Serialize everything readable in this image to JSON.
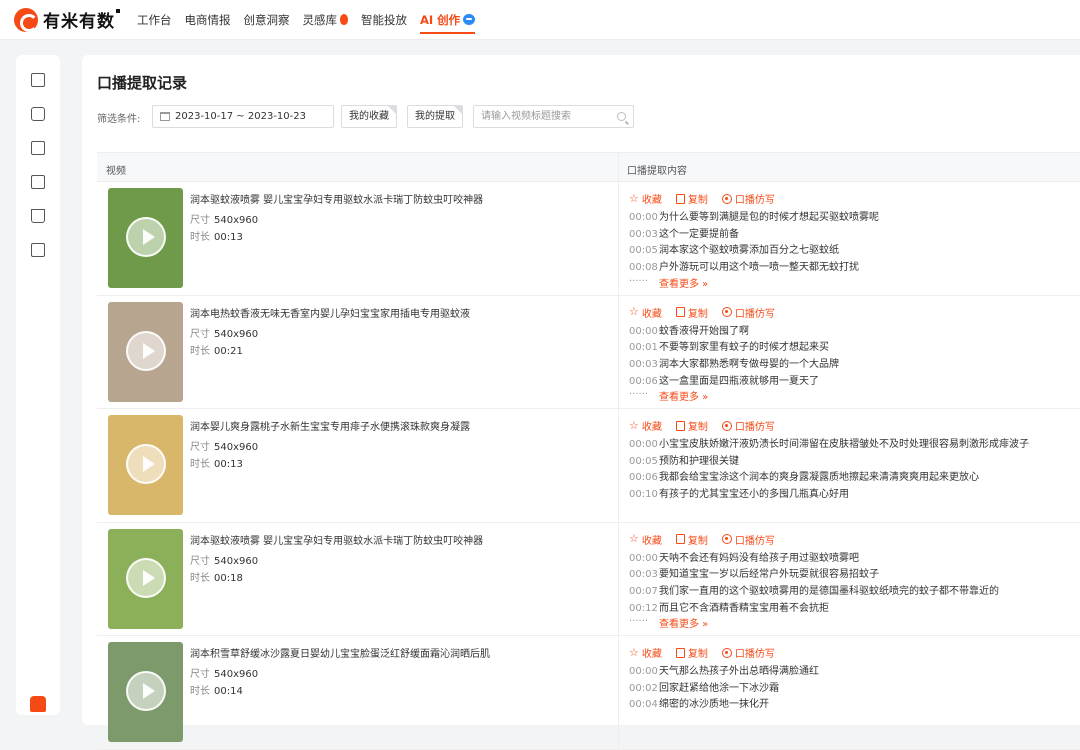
{
  "nav": {
    "brand": "有米有数",
    "links": [
      "工作台",
      "电商情报",
      "创意洞察",
      "灵感库",
      "智能投放",
      "AI 创作"
    ],
    "active": "AI 创作"
  },
  "sidebar": {
    "icons": [
      "ai-chip-icon",
      "video-play-icon",
      "chat-icon",
      "book-icon",
      "cart-icon",
      "list-icon"
    ]
  },
  "page": {
    "title": "口播提取记录",
    "filter_label": "筛选条件:",
    "date_range": "2023-10-17 ~ 2023-10-23",
    "chip_favorites": "我的收藏",
    "chip_extracted": "我的提取",
    "search_placeholder": "请输入视频标题搜索"
  },
  "table": {
    "col_video": "视频",
    "col_content": "口播提取内容",
    "size_label": "尺寸",
    "duration_label": "时长",
    "actions": {
      "favorite": "收藏",
      "copy": "复制",
      "imitate": "口播仿写"
    },
    "see_more": "查看更多",
    "ellipsis": "......",
    "rows": [
      {
        "title": "润本驱蚊液喷雾 婴儿宝宝孕妇专用驱蚊水派卡瑞丁防蚊虫叮咬神器",
        "size": "540x960",
        "duration": "00:13",
        "thumb_color": "#6f9a4a",
        "lines": [
          {
            "t": "00:00",
            "text": "为什么要等到满腿是包的时候才想起买驱蚊喷雾呢"
          },
          {
            "t": "00:03",
            "text": "这个一定要提前备"
          },
          {
            "t": "00:05",
            "text": "润本家这个驱蚊喷雾添加百分之七驱蚊纸"
          },
          {
            "t": "00:08",
            "text": "户外游玩可以用这个喷一喷一整天都无蚊打扰"
          }
        ],
        "has_more": true
      },
      {
        "title": "润本电热蚊香液无味无香室内婴儿孕妇宝宝家用插电专用驱蚊液",
        "size": "540x960",
        "duration": "00:21",
        "thumb_color": "#b8a590",
        "lines": [
          {
            "t": "00:00",
            "text": "蚊香液得开始囤了啊"
          },
          {
            "t": "00:01",
            "text": "不要等到家里有蚊子的时候才想起来买"
          },
          {
            "t": "00:03",
            "text": "润本大家都熟悉啊专做母婴的一个大品牌"
          },
          {
            "t": "00:06",
            "text": "这一盒里面是四瓶液就够用一夏天了"
          }
        ],
        "has_more": true
      },
      {
        "title": "润本婴儿爽身露桃子水新生宝宝专用痱子水便携滚珠款爽身凝露",
        "size": "540x960",
        "duration": "00:13",
        "thumb_color": "#d9b76a",
        "lines": [
          {
            "t": "00:00",
            "text": "小宝宝皮肤娇嫩汗液奶渍长时间滞留在皮肤褶皱处不及时处理很容易刺激形成痱波子"
          },
          {
            "t": "00:05",
            "text": "预防和护理很关键"
          },
          {
            "t": "00:06",
            "text": "我都会给宝宝涂这个润本的爽身露凝露质地擦起来清清爽爽用起来更放心"
          },
          {
            "t": "00:10",
            "text": "有孩子的尤其宝宝还小的多囤几瓶真心好用"
          }
        ],
        "has_more": false
      },
      {
        "title": "润本驱蚊液喷雾 婴儿宝宝孕妇专用驱蚊水派卡瑞丁防蚊虫叮咬神器",
        "size": "540x960",
        "duration": "00:18",
        "thumb_color": "#8cb05a",
        "lines": [
          {
            "t": "00:00",
            "text": "天呐不会还有妈妈没有给孩子用过驱蚊喷雾吧"
          },
          {
            "t": "00:03",
            "text": "要知道宝宝一岁以后经常户外玩耍就很容易招蚊子"
          },
          {
            "t": "00:07",
            "text": "我们家一直用的这个驱蚊喷雾用的是德国墨科驱蚊纸喷完的蚊子都不带靠近的"
          },
          {
            "t": "00:12",
            "text": "而且它不含酒精香精宝宝用着不会抗拒"
          }
        ],
        "has_more": true
      },
      {
        "title": "润本积雪草舒缓冰沙露夏日婴幼儿宝宝脸蛋泛红舒缓面霜沁润晒后肌",
        "size": "540x960",
        "duration": "00:14",
        "thumb_color": "#7d9a6c",
        "lines": [
          {
            "t": "00:00",
            "text": "天气那么热孩子外出总晒得满脸通红"
          },
          {
            "t": "00:02",
            "text": "回家赶紧给他涂一下冰沙霜"
          },
          {
            "t": "00:04",
            "text": "绵密的冰沙质地一抹化开"
          }
        ],
        "has_more": false
      }
    ]
  },
  "colors": {
    "accent": "#f54a16",
    "link_blue": "#2a8cf5"
  }
}
